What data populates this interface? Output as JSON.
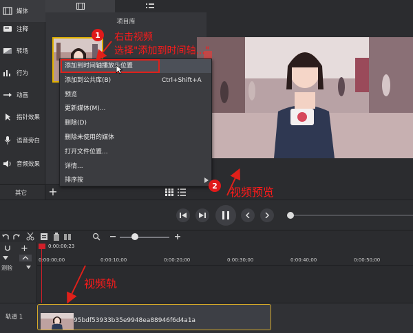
{
  "sidebar": {
    "items": [
      {
        "label": "媒体",
        "icon": "film-icon"
      },
      {
        "label": "注释",
        "icon": "annotation-icon"
      },
      {
        "label": "转场",
        "icon": "transition-icon"
      },
      {
        "label": "行为",
        "icon": "behavior-icon"
      },
      {
        "label": "动画",
        "icon": "animation-icon"
      },
      {
        "label": "指针效果",
        "icon": "cursor-effect-icon"
      },
      {
        "label": "语音旁白",
        "icon": "microphone-icon"
      },
      {
        "label": "音频效果",
        "icon": "speaker-icon"
      }
    ],
    "more_label": "其它"
  },
  "media_panel": {
    "title": "项目库"
  },
  "context_menu": {
    "items": [
      {
        "label": "添加到时间轴播放头位置",
        "shortcut": ""
      },
      {
        "label": "添加到公共库(B)",
        "shortcut": "Ctrl+Shift+A"
      },
      {
        "label": "预览",
        "shortcut": ""
      },
      {
        "label": "更新媒体(M)...",
        "shortcut": ""
      },
      {
        "label": "删除(D)",
        "shortcut": ""
      },
      {
        "label": "删除未使用的媒体",
        "shortcut": ""
      },
      {
        "label": "打开文件位置...",
        "shortcut": ""
      },
      {
        "label": "详情...",
        "shortcut": ""
      },
      {
        "label": "排序按",
        "shortcut": ""
      }
    ]
  },
  "annotations": {
    "step1_line1": "右击视频",
    "step1_line2": "选择\"添加到时间轴...\"",
    "step2": "视频预览",
    "track_note": "视频轨",
    "badge1": "1",
    "badge2": "2"
  },
  "timeline": {
    "playhead_time": "0:00:00;23",
    "ticks": [
      "0:00:00;00",
      "0:00:10;00",
      "0:00:20;00",
      "0:00:30;00",
      "0:00:40;00",
      "0:00:50;00"
    ],
    "group_label": "测验",
    "track_label": "轨道 1",
    "clip_name": "95bdf53933b35e9948ea88946f6d4a1a"
  },
  "colors": {
    "accent_red": "#e0201a",
    "clip_border": "#d5a928",
    "panel_bg": "#35363a"
  }
}
